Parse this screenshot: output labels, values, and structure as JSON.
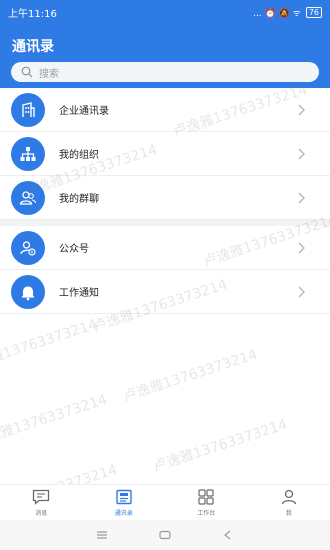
{
  "status_bar": {
    "time": "上午11:16",
    "indicators": "... ⏰ 🔕 ᯤ",
    "battery": "76"
  },
  "header": {
    "title": "通讯录",
    "search_placeholder": "搜索"
  },
  "contacts": [
    {
      "label": "企业通讯录",
      "icon": "building-icon"
    },
    {
      "label": "我的组织",
      "icon": "org-chart-icon"
    },
    {
      "label": "我的群聊",
      "icon": "group-chat-icon"
    }
  ],
  "services": [
    {
      "label": "公众号",
      "icon": "official-account-icon"
    },
    {
      "label": "工作通知",
      "icon": "bell-icon"
    }
  ],
  "watermark_text": "卢逸雅13763373214",
  "tabbar": [
    {
      "label": "消息",
      "icon": "message-icon",
      "active": false
    },
    {
      "label": "通讯录",
      "icon": "contacts-icon",
      "active": true
    },
    {
      "label": "工作台",
      "icon": "workbench-icon",
      "active": false
    },
    {
      "label": "我",
      "icon": "profile-icon",
      "active": false
    }
  ],
  "colors": {
    "primary": "#2f7be6",
    "background": "#ffffff"
  }
}
